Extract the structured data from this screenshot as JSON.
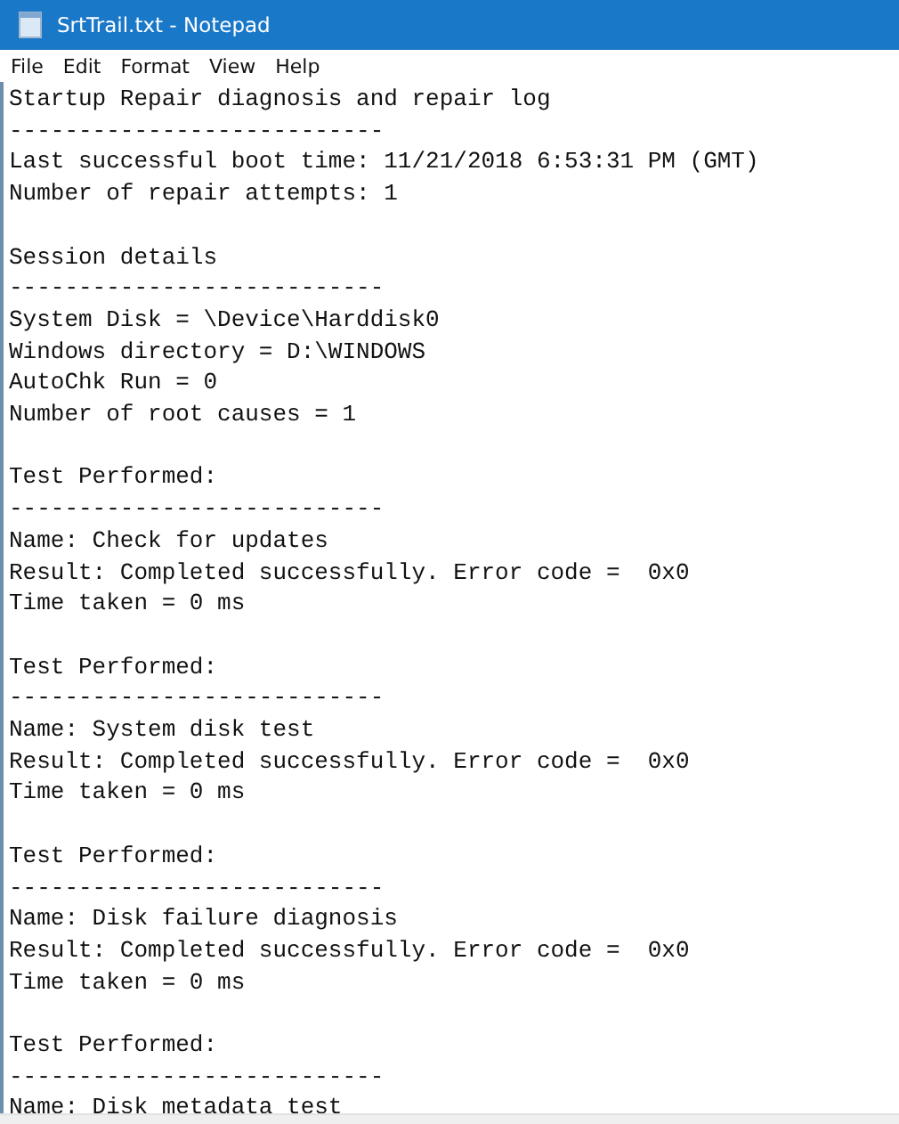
{
  "window": {
    "title": "SrtTrail.txt - Notepad"
  },
  "menu": [
    "File",
    "Edit",
    "Format",
    "View",
    "Help"
  ],
  "blocks": [
    [
      "Startup Repair diagnosis and repair log",
      "---------------------------",
      "Last successful boot time: 11/21/2018 6:53:31 PM (GMT)",
      "Number of repair attempts: 1"
    ],
    [
      "Session details",
      "---------------------------",
      "System Disk = \\Device\\Harddisk0",
      "Windows directory = D:\\WINDOWS",
      "AutoChk Run = 0",
      "Number of root causes = 1"
    ],
    [
      "Test Performed:",
      "---------------------------",
      "Name: Check for updates",
      "Result: Completed successfully. Error code =  0x0",
      "Time taken = 0 ms"
    ],
    [
      "Test Performed:",
      "---------------------------",
      "Name: System disk test",
      "Result: Completed successfully. Error code =  0x0",
      "Time taken = 0 ms"
    ],
    [
      "Test Performed:",
      "---------------------------",
      "Name: Disk failure diagnosis",
      "Result: Completed successfully. Error code =  0x0",
      "Time taken = 0 ms"
    ],
    [
      "Test Performed:",
      "---------------------------",
      "Name: Disk metadata test"
    ]
  ]
}
